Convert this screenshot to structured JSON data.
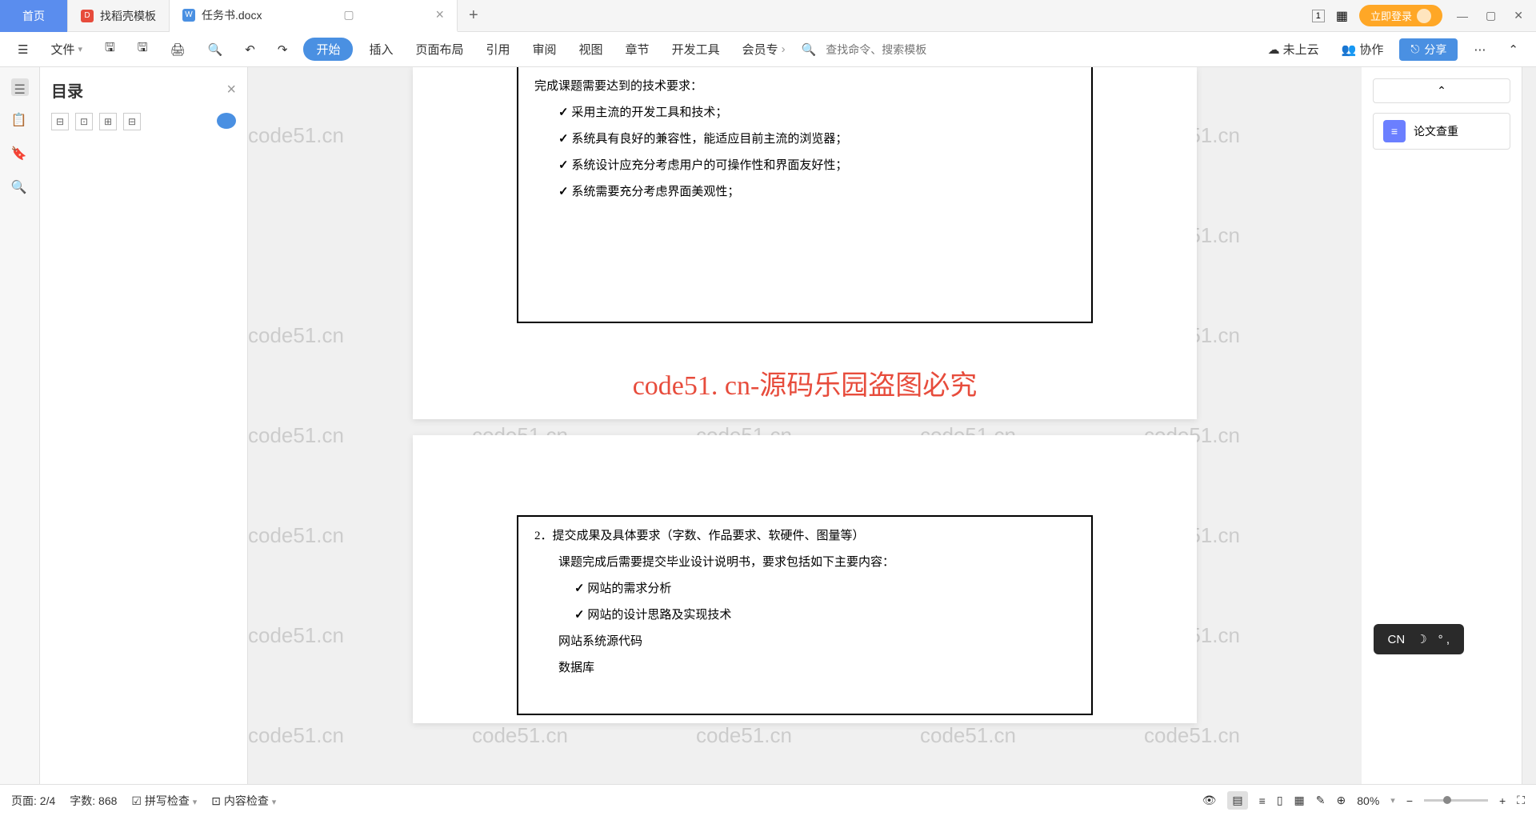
{
  "tabs": {
    "home": "首页",
    "template": "找稻壳模板",
    "doc": "任务书.docx"
  },
  "titlebar": {
    "login": "立即登录"
  },
  "toolbar": {
    "file": "文件",
    "start": "开始",
    "insert": "插入",
    "layout": "页面布局",
    "reference": "引用",
    "review": "审阅",
    "view": "视图",
    "chapter": "章节",
    "devtools": "开发工具",
    "member": "会员专",
    "search_placeholder": "查找命令、搜索模板",
    "cloud": "未上云",
    "collab": "协作",
    "share": "分享"
  },
  "outline": {
    "title": "目录"
  },
  "doc": {
    "p1_l1": "完成课题需要达到的技术要求：",
    "p1_l2": "采用主流的开发工具和技术；",
    "p1_l3": "系统具有良好的兼容性，能适应目前主流的浏览器；",
    "p1_l4": "系统设计应充分考虑用户的可操作性和界面友好性；",
    "p1_l5": "系统需要充分考虑界面美观性；",
    "red": "code51. cn-源码乐园盗图必究",
    "p2_h": "2．提交成果及具体要求（字数、作品要求、软硬件、图量等）",
    "p2_l1": "课题完成后需要提交毕业设计说明书，要求包括如下主要内容：",
    "p2_l2": "网站的需求分析",
    "p2_l3": "网站的设计思路及实现技术",
    "p2_l4": "网站系统源代码",
    "p2_l5": "数据库"
  },
  "rightpanel": {
    "check": "论文查重"
  },
  "status": {
    "page": "页面: 2/4",
    "words": "字数: 868",
    "spell": "拼写检查",
    "content": "内容检查",
    "zoom": "80%"
  },
  "ime": {
    "lang": "CN"
  },
  "watermark": "code51.cn"
}
